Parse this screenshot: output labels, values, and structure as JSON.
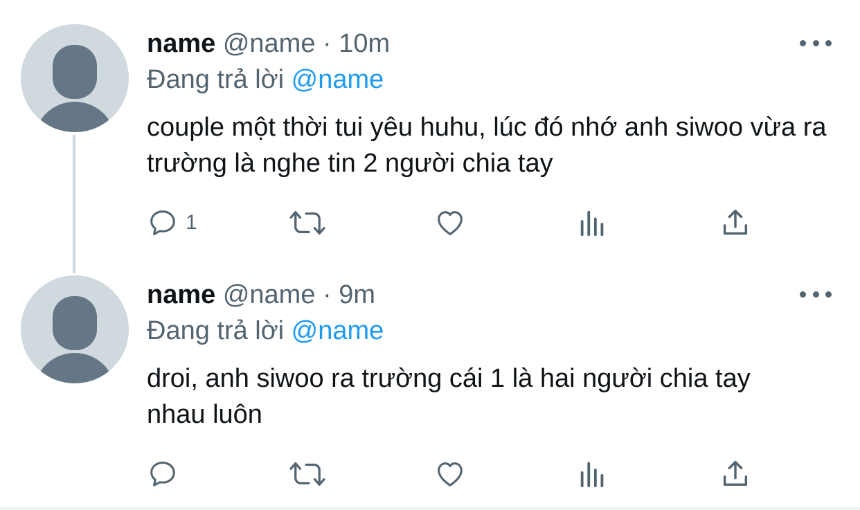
{
  "tweets": [
    {
      "author_name": "name",
      "handle": "@name",
      "separator": "·",
      "time": "10m",
      "reply_prefix": "Đang trả lời",
      "reply_to": "@name",
      "text": "couple một thời tui yêu huhu, lúc đó nhớ anh siwoo vừa ra trường là nghe tin 2 người chia tay",
      "reply_count": "1"
    },
    {
      "author_name": "name",
      "handle": "@name",
      "separator": "·",
      "time": "9m",
      "reply_prefix": "Đang trả lời",
      "reply_to": "@name",
      "text": "droi, anh siwoo ra trường cái 1 là hai người chia tay nhau luôn",
      "reply_count": ""
    }
  ],
  "icons": {
    "reply": "speech-bubble-icon",
    "retweet": "retweet-arrows-icon",
    "like": "heart-icon",
    "analytics": "bar-chart-icon",
    "share": "share-upload-icon",
    "more": "ellipsis-icon",
    "avatar": "default-person-silhouette"
  },
  "colors": {
    "text": "#0f1419",
    "muted": "#536471",
    "mention": "#1d9bf0",
    "avatar_bg": "#cfd9de",
    "avatar_fg": "#657786",
    "thread_line": "#cfd9de"
  }
}
